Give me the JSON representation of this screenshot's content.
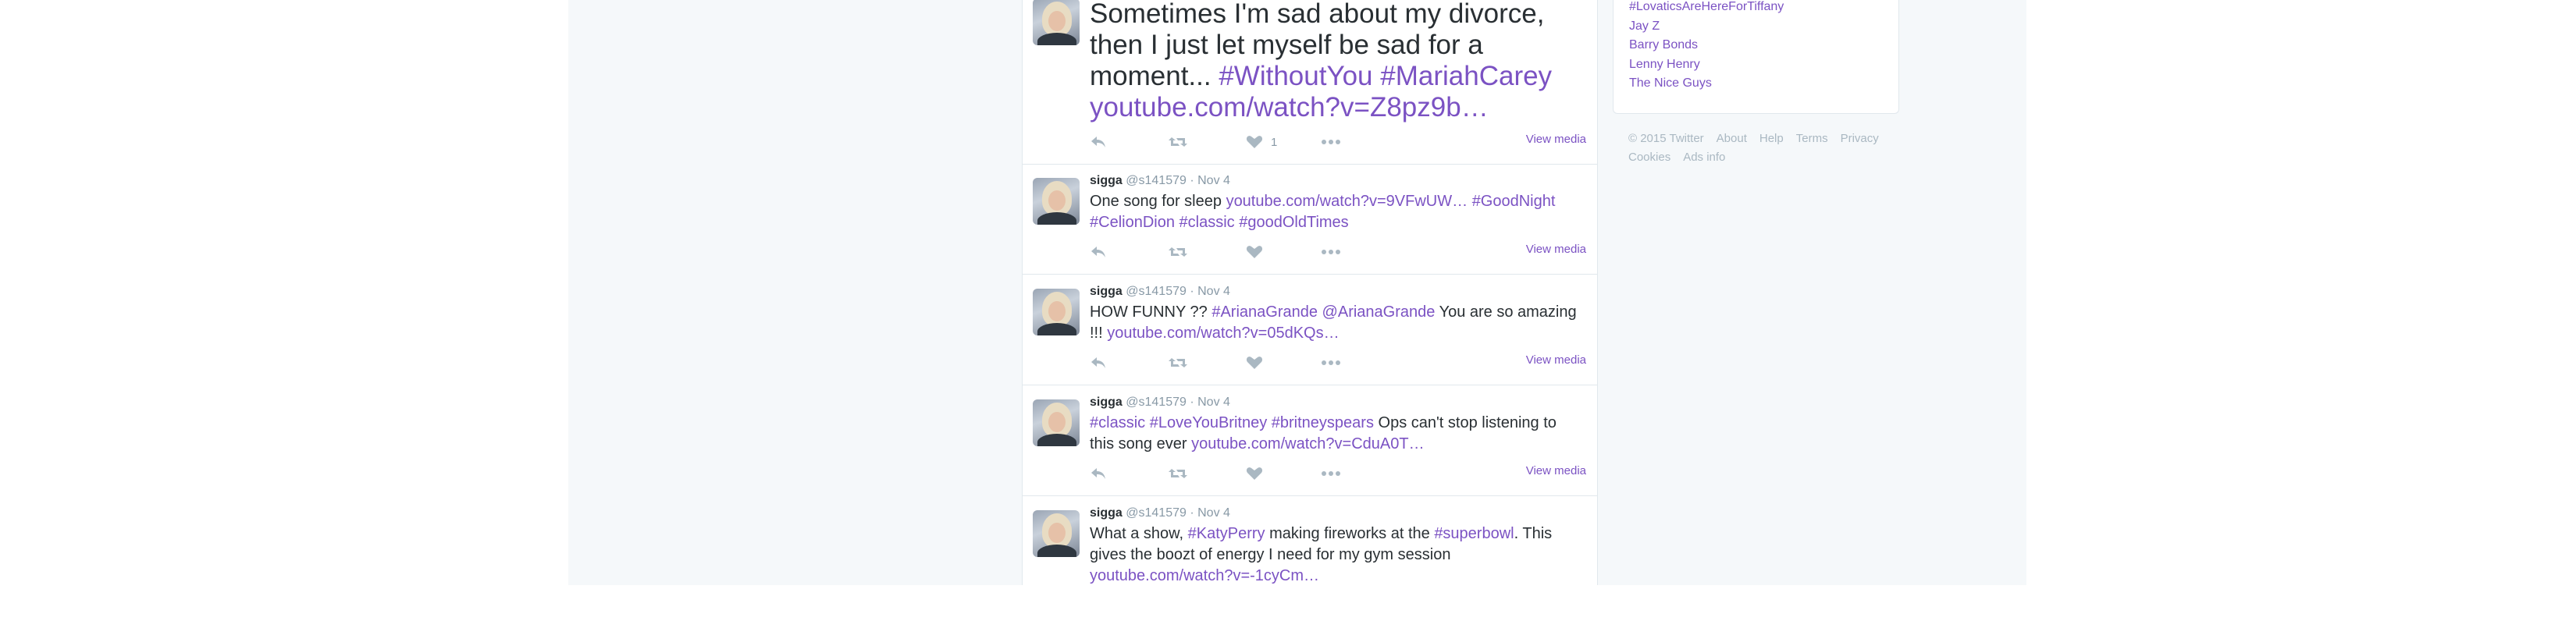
{
  "tweets": [
    {
      "text_parts": [
        {
          "t": "Sometimes I'm sad about my divorce, then I just let myself be sad for a moment... ",
          "link": false
        },
        {
          "t": "#WithoutYou",
          "link": true
        },
        {
          "t": " ",
          "link": false
        },
        {
          "t": "#MariahCarey",
          "link": true
        },
        {
          "t": " ",
          "link": false
        },
        {
          "t": "youtube.com/watch?v=Z8pz9b…",
          "link": true
        }
      ],
      "like_count": "1",
      "view_media": "View media"
    },
    {
      "name": "sigga",
      "handle": "@s141579",
      "sep": "·",
      "time": "Nov 4",
      "text_parts": [
        {
          "t": "One song for sleep ",
          "link": false
        },
        {
          "t": "youtube.com/watch?v=9VFwUW…",
          "link": true
        },
        {
          "t": " ",
          "link": false
        },
        {
          "t": "#GoodNight",
          "link": true
        },
        {
          "t": " ",
          "link": false
        },
        {
          "t": "#CelionDion",
          "link": true
        },
        {
          "t": " ",
          "link": false
        },
        {
          "t": "#classic",
          "link": true
        },
        {
          "t": " ",
          "link": false
        },
        {
          "t": "#goodOldTimes",
          "link": true
        }
      ],
      "like_count": "",
      "view_media": "View media"
    },
    {
      "name": "sigga",
      "handle": "@s141579",
      "sep": "·",
      "time": "Nov 4",
      "text_parts": [
        {
          "t": "HOW FUNNY ?? ",
          "link": false
        },
        {
          "t": "#ArianaGrande",
          "link": true
        },
        {
          "t": " ",
          "link": false
        },
        {
          "t": "@ArianaGrande",
          "link": true
        },
        {
          "t": " You are so amazing !!! ",
          "link": false
        },
        {
          "t": "youtube.com/watch?v=05dKQs…",
          "link": true
        }
      ],
      "like_count": "",
      "view_media": "View media"
    },
    {
      "name": "sigga",
      "handle": "@s141579",
      "sep": "·",
      "time": "Nov 4",
      "text_parts": [
        {
          "t": "#classic",
          "link": true
        },
        {
          "t": " ",
          "link": false
        },
        {
          "t": "#LoveYouBritney",
          "link": true
        },
        {
          "t": " ",
          "link": false
        },
        {
          "t": "#britneyspears",
          "link": true
        },
        {
          "t": " Ops can't stop listening to this song ever ",
          "link": false
        },
        {
          "t": "youtube.com/watch?v=CduA0T…",
          "link": true
        }
      ],
      "like_count": "",
      "view_media": "View media"
    },
    {
      "name": "sigga",
      "handle": "@s141579",
      "sep": "·",
      "time": "Nov 4",
      "text_parts": [
        {
          "t": "What a show, ",
          "link": false
        },
        {
          "t": "#KatyPerry",
          "link": true
        },
        {
          "t": " making fireworks at the ",
          "link": false
        },
        {
          "t": "#superbowl",
          "link": true
        },
        {
          "t": ". This gives the boozt of energy I need for my gym session ",
          "link": false
        },
        {
          "t": "youtube.com/watch?v=-1cyCm…",
          "link": true
        }
      ]
    }
  ],
  "sidebar": {
    "trends": [
      "#LovaticsAreHereForTiffany",
      "Jay Z",
      "Barry Bonds",
      "Lenny Henry",
      "The Nice Guys"
    ]
  },
  "footer": {
    "links": [
      "© 2015 Twitter",
      "About",
      "Help",
      "Terms",
      "Privacy",
      "Cookies",
      "Ads info"
    ]
  },
  "colors": {
    "link": "#7b52c3",
    "action_icon": "#aab8c2",
    "page_background": "#f5f8fa"
  },
  "icons": [
    "reply-icon",
    "retweet-icon",
    "like-icon",
    "more-icon"
  ]
}
